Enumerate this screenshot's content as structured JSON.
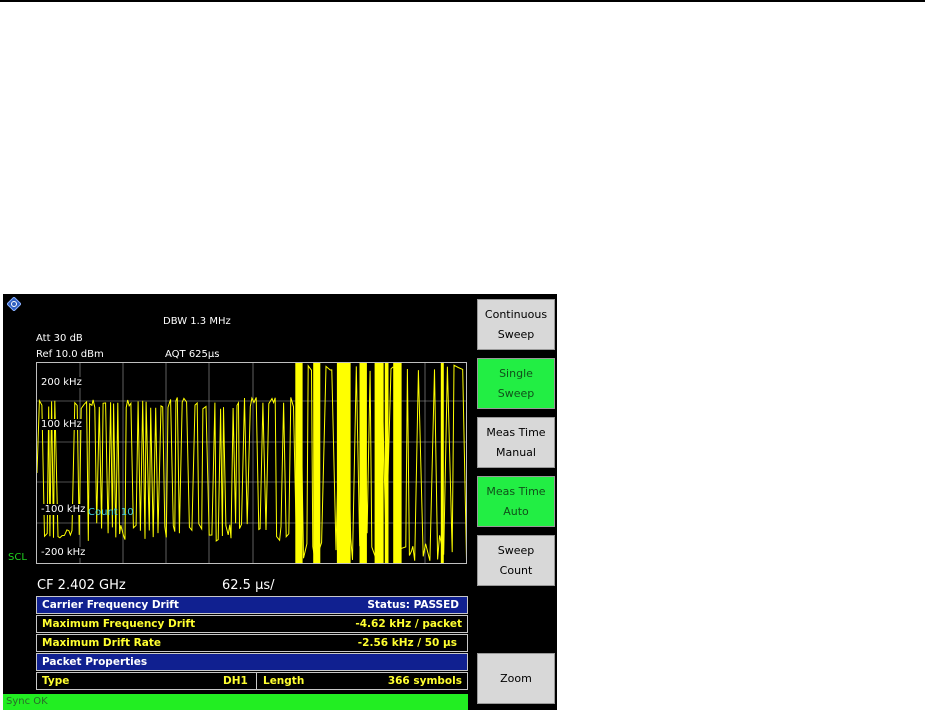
{
  "screen": {
    "header": {
      "dbw": "DBW 1.3 MHz",
      "att": "Att  30 dB",
      "ref": "Ref  10.0 dBm",
      "aqt": "AQT  625µs"
    },
    "plot": {
      "y_labels": [
        "200 kHz",
        "100 kHz",
        "-100 kHz",
        "-200 kHz"
      ],
      "count_label": "Count 10",
      "trace_color": "#ffff00",
      "grid_color": "#a0a0a0"
    },
    "scl_label": "SCL",
    "cf": "CF 2.402 GHz",
    "span": "62.5 µs/",
    "table": {
      "title": "Carrier Frequency Drift",
      "status": "Status: PASSED",
      "max_freq_drift_label": "Maximum Frequency Drift",
      "max_freq_drift_value": "-4.62 kHz  / packet",
      "max_drift_rate_label": "Maximum Drift Rate",
      "max_drift_rate_value": "-2.56 kHz  / 50 µs",
      "packet_props_label": "Packet Properties",
      "type_label": "Type",
      "type_value": "DH1",
      "length_label": "Length",
      "length_value": "366 symbols"
    },
    "status_bar": "Sync OK"
  },
  "softkeys": [
    {
      "line1": "Continuous",
      "line2": "Sweep",
      "active": false
    },
    {
      "line1": "Single",
      "line2": "Sweep",
      "active": true
    },
    {
      "line1": "Meas Time",
      "line2": "Manual",
      "active": false
    },
    {
      "line1": "Meas Time",
      "line2": "Auto",
      "active": true
    },
    {
      "line1": "Sweep",
      "line2": "Count",
      "active": false
    },
    {
      "line1": "Zoom",
      "line2": "",
      "active": false
    }
  ],
  "colors": {
    "softkey_active": "#22ee44",
    "softkey_inactive": "#d8d8d8",
    "table_header": "#102090",
    "value_text": "#ffff30",
    "status_bar": "#22ee22"
  }
}
